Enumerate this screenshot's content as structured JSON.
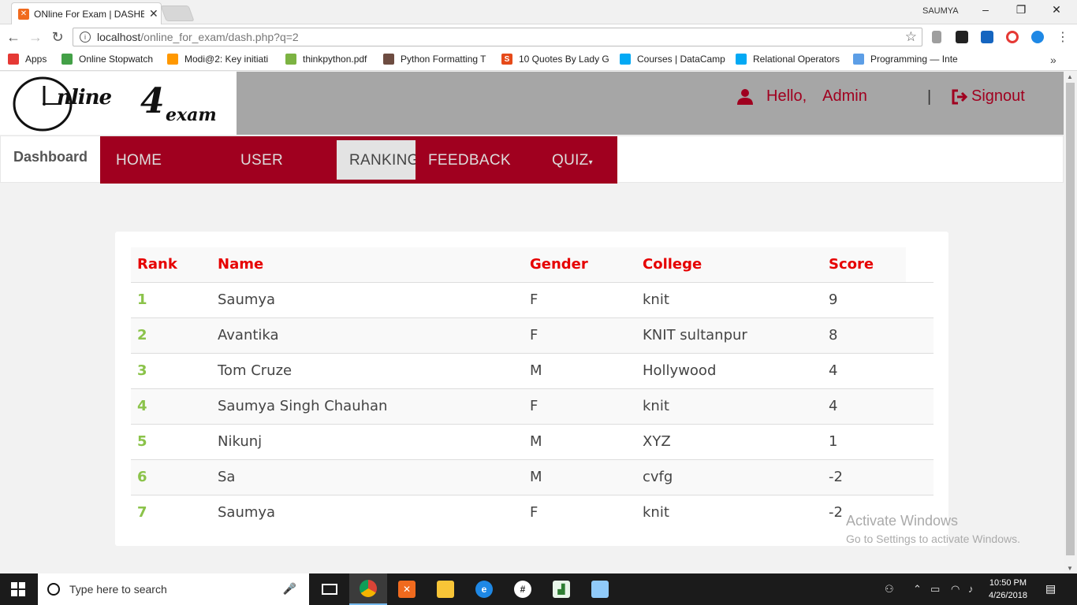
{
  "browser": {
    "tab_title": "ONline For Exam | DASHB",
    "window_user": "SAUMYA",
    "url_host": "localhost",
    "url_path": "/online_for_exam/dash.php?q=2",
    "bookmarks": [
      {
        "label": "Apps",
        "icon": "apps-grid-icon",
        "color": "#e53935"
      },
      {
        "label": "Online Stopwatch",
        "icon": "stopwatch-icon",
        "color": "#43a047"
      },
      {
        "label": "Modi@2: Key initiati",
        "icon": "rainbow-icon",
        "color": "#ff9800"
      },
      {
        "label": "thinkpython.pdf",
        "icon": "sprout-icon",
        "color": "#7cb342"
      },
      {
        "label": "Python Formatting T",
        "icon": "dog-icon",
        "color": "#6d4c41"
      },
      {
        "label": "10 Quotes By Lady G",
        "icon": "s-icon",
        "color": "#e64a19"
      },
      {
        "label": "Courses | DataCamp",
        "icon": "shield-icon",
        "color": "#03a9f4"
      },
      {
        "label": "Relational Operators",
        "icon": "shield-icon",
        "color": "#03a9f4"
      },
      {
        "label": "Programming — Inte",
        "icon": "ib-icon",
        "color": "#5c9ee6"
      }
    ]
  },
  "header": {
    "logo_text": "nline",
    "logo_four": "4",
    "logo_exam": "exam",
    "greeting": "Hello,",
    "username": "Admin",
    "separator": "|",
    "signout": "Signout"
  },
  "nav": {
    "brand": "Dashboard",
    "items": [
      "HOME",
      "USER",
      "RANKING",
      "FEEDBACK",
      "QUIZ"
    ],
    "active": "RANKING",
    "accent": "#a0001f"
  },
  "table": {
    "headers": [
      "Rank",
      "Name",
      "Gender",
      "College",
      "Score"
    ],
    "rows": [
      [
        "1",
        "Saumya",
        "F",
        "knit",
        "9"
      ],
      [
        "2",
        "Avantika",
        "F",
        "KNIT sultanpur",
        "8"
      ],
      [
        "3",
        "Tom Cruze",
        "M",
        "Hollywood",
        "4"
      ],
      [
        "4",
        "Saumya Singh Chauhan",
        "F",
        "knit",
        "4"
      ],
      [
        "5",
        "Nikunj",
        "M",
        "XYZ",
        "1"
      ],
      [
        "6",
        "Sa",
        "M",
        "cvfg",
        "-2"
      ],
      [
        "7",
        "Saumya",
        "F",
        "knit",
        "-2"
      ]
    ]
  },
  "watermark": {
    "line1": "Activate Windows",
    "line2": "Go to Settings to activate Windows."
  },
  "taskbar": {
    "search_placeholder": "Type here to search",
    "time": "10:50 PM",
    "date": "4/26/2018"
  }
}
